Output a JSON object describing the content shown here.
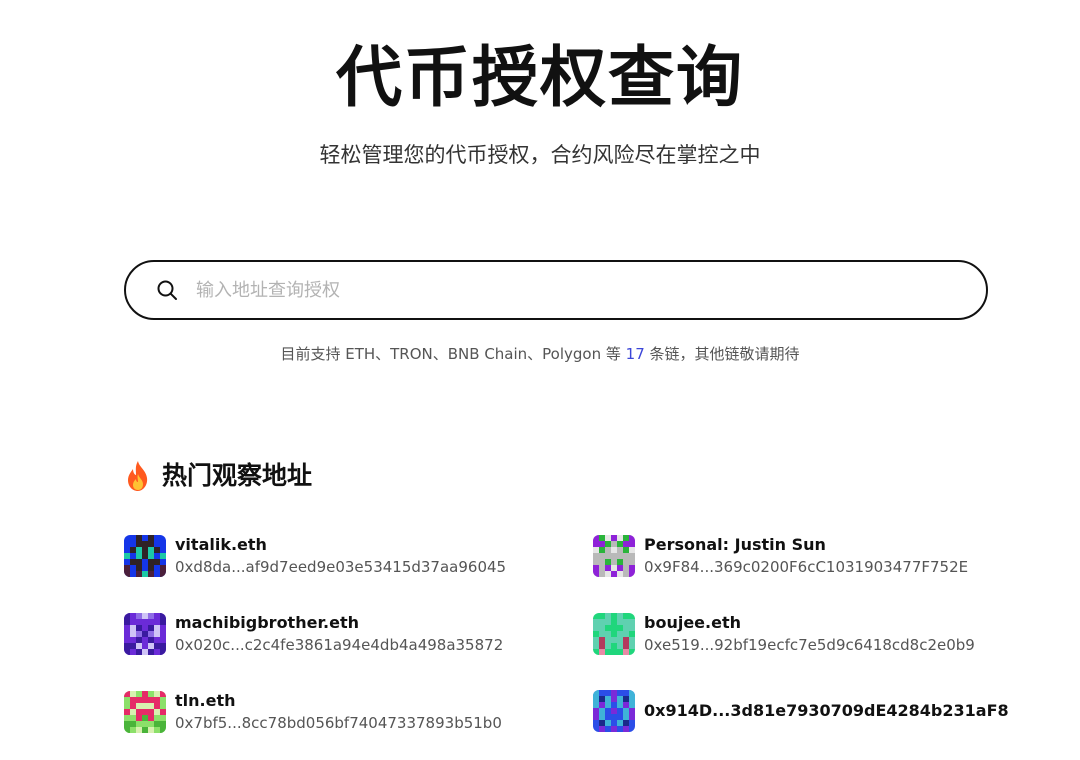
{
  "hero": {
    "title": "代币授权查询",
    "subtitle": "轻松管理您的代币授权，合约风险尽在掌控之中"
  },
  "search": {
    "placeholder": "输入地址查询授权",
    "value": ""
  },
  "support": {
    "prefix": "目前支持 ETH、TRON、BNB Chain、Polygon 等 ",
    "count": "17",
    "suffix": " 条链，其他链敬请期待"
  },
  "section": {
    "icon": "fire-icon",
    "title": "热门观察地址"
  },
  "watch_addresses": [
    {
      "name": "vitalik.eth",
      "address": "0xd8da...af9d7eed9e03e53415d37aa96045",
      "palette": [
        "#1536e8",
        "#2f2226",
        "#1cc9a6",
        "#4b1f3a"
      ]
    },
    {
      "name": "Personal: Justin Sun",
      "address": "0x9F84...369c0200F6cC1031903477F752E",
      "palette": [
        "#b9b9b9",
        "#8e22d8",
        "#2ab43b",
        "#e6e6e6"
      ]
    },
    {
      "name": "machibigbrother.eth",
      "address": "0x020c...c2c4fe3861a94e4db4a498a35872",
      "palette": [
        "#6b2bd8",
        "#cfc4f6",
        "#3a1aa0",
        "#8f6ce6"
      ]
    },
    {
      "name": "boujee.eth",
      "address": "0xe519...92bf19ecfc7e5d9c6418cd8c2e0b9",
      "palette": [
        "#20d67c",
        "#b33a5d",
        "#5fd1b0",
        "#e88aa6"
      ]
    },
    {
      "name": "tln.eth",
      "address": "0x7bf5...8cc78bd056bf74047337893b51b0",
      "palette": [
        "#8ce06a",
        "#e52b68",
        "#4ab43a",
        "#d8f0b0"
      ]
    },
    {
      "name": "",
      "address": "0x914D...3d81e7930709dE4284b231aF8",
      "palette": [
        "#2b4ee8",
        "#3fb3d8",
        "#7b2ad8",
        "#1a2a8a"
      ]
    }
  ]
}
